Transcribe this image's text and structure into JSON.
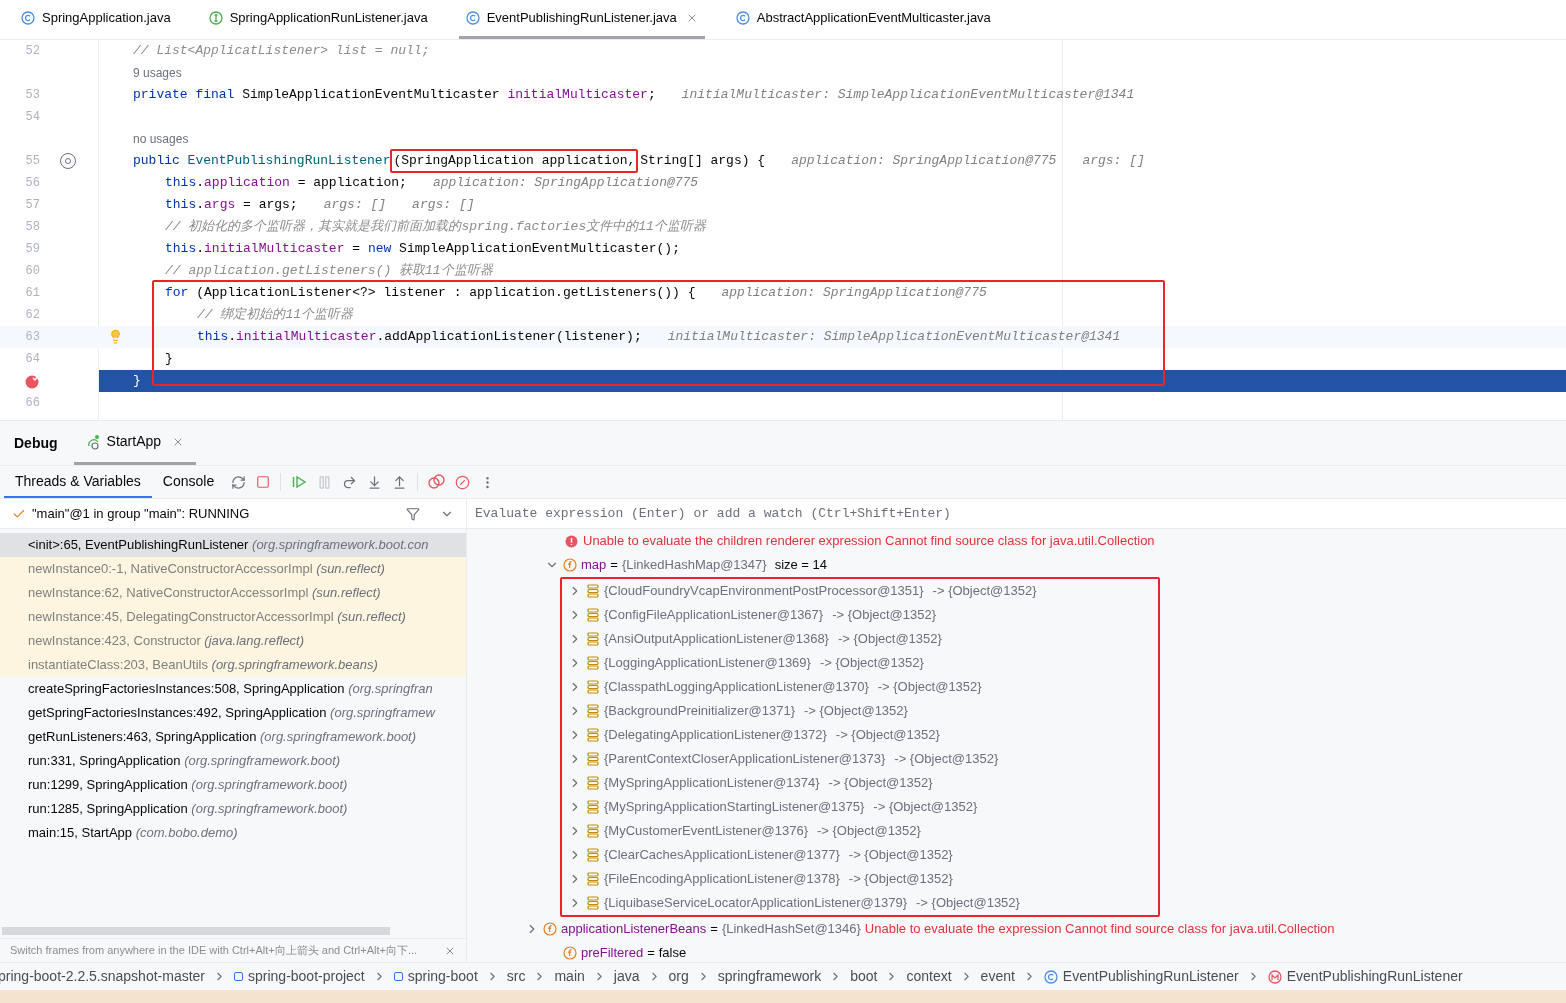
{
  "editor_tabs": [
    {
      "label": "SpringApplication.java",
      "kind": "class",
      "selected": false
    },
    {
      "label": "SpringApplicationRunListener.java",
      "kind": "interface",
      "selected": false
    },
    {
      "label": "EventPublishingRunListener.java",
      "kind": "class",
      "selected": true,
      "closable": true
    },
    {
      "label": "AbstractApplicationEventMulticaster.java",
      "kind": "class",
      "selected": false
    }
  ],
  "code": {
    "lines": [
      {
        "kind": "code",
        "number": "52",
        "tokens": [
          {
            "kind": "comment",
            "text": "// List<ApplicatListener> list = null;"
          }
        ]
      },
      {
        "kind": "usage",
        "text": "9 usages"
      },
      {
        "kind": "code",
        "number": "53",
        "tokens": [
          {
            "kind": "keyword",
            "text": "private final "
          },
          {
            "kind": "plain",
            "text": "SimpleApplicationEventMulticaster "
          },
          {
            "kind": "field",
            "text": "initialMulticaster"
          },
          {
            "kind": "plain",
            "text": ";"
          },
          {
            "kind": "hint",
            "text": "initialMulticaster: SimpleApplicationEventMulticaster@1341"
          }
        ]
      },
      {
        "kind": "code",
        "number": "54"
      },
      {
        "kind": "usage",
        "text": "no usages"
      },
      {
        "kind": "code",
        "number": "55",
        "gutter": {
          "kind": "implements"
        },
        "tokens": [
          {
            "kind": "keyword",
            "text": "public "
          },
          {
            "kind": "declaration",
            "text": "EventPublishingRunListener"
          },
          {
            "kind": "plain",
            "text": "(SpringApplication application,",
            "boxed": true
          },
          {
            "kind": "plain",
            "text": "String[] args) {"
          },
          {
            "kind": "hint",
            "text": "application: SpringApplication@775"
          },
          {
            "kind": "hint",
            "text": "args: []"
          }
        ],
        "children": [
          {
            "kind": "code",
            "number": "56",
            "tokens": [
              {
                "kind": "keyword",
                "text": "this"
              },
              {
                "kind": "plain",
                "text": "."
              },
              {
                "kind": "field",
                "text": "application"
              },
              {
                "kind": "plain",
                "text": " = application;"
              },
              {
                "kind": "hint",
                "text": "application: SpringApplication@775"
              }
            ]
          },
          {
            "kind": "code",
            "number": "57",
            "tokens": [
              {
                "kind": "keyword",
                "text": "this"
              },
              {
                "kind": "plain",
                "text": "."
              },
              {
                "kind": "field",
                "text": "args"
              },
              {
                "kind": "plain",
                "text": " = args;"
              },
              {
                "kind": "hint",
                "text": "args: []"
              },
              {
                "kind": "hint",
                "text": "args: []"
              }
            ]
          },
          {
            "kind": "code",
            "number": "58",
            "tokens": [
              {
                "kind": "comment",
                "text": "// 初始化的多个监听器，其实就是我们前面加载的spring.factories文件中的11个监听器"
              }
            ]
          },
          {
            "kind": "code",
            "number": "59",
            "tokens": [
              {
                "kind": "keyword",
                "text": "this"
              },
              {
                "kind": "plain",
                "text": "."
              },
              {
                "kind": "field",
                "text": "initialMulticaster"
              },
              {
                "kind": "plain",
                "text": " = "
              },
              {
                "kind": "keyword",
                "text": "new "
              },
              {
                "kind": "plain",
                "text": "SimpleApplicationEventMulticaster();"
              }
            ]
          },
          {
            "kind": "code",
            "number": "60",
            "tokens": [
              {
                "kind": "comment",
                "text": "// application.getListeners() 获取11个监听器"
              }
            ]
          },
          {
            "kind": "code",
            "number": "61",
            "boxed": true,
            "tokens": [
              {
                "kind": "keyword",
                "text": "for "
              },
              {
                "kind": "plain",
                "text": "(ApplicationListener<?> listener : application.getListeners()) {"
              },
              {
                "kind": "hint",
                "text": "application: SpringApplication@775"
              }
            ],
            "children": [
              {
                "kind": "code",
                "number": "62",
                "boxed": true,
                "tokens": [
                  {
                    "kind": "comment",
                    "text": "// 绑定初始的11个监听器"
                  }
                ]
              },
              {
                "kind": "code",
                "number": "63",
                "boxed": true,
                "caret": true,
                "gutter": {
                  "kind": "bulb"
                },
                "tokens": [
                  {
                    "kind": "keyword",
                    "text": "this"
                  },
                  {
                    "kind": "plain",
                    "text": "."
                  },
                  {
                    "kind": "field",
                    "text": "initialMulticaster"
                  },
                  {
                    "kind": "plain",
                    "text": ".addApplicationListener(listener);"
                  },
                  {
                    "kind": "hint",
                    "text": "initialMulticaster: SimpleApplicationEventMulticaster@1341"
                  }
                ]
              }
            ]
          },
          {
            "kind": "code",
            "number": "64",
            "boxed": true,
            "tokens": [
              {
                "kind": "plain",
                "text": "}"
              }
            ]
          }
        ]
      },
      {
        "kind": "code",
        "execution": true,
        "gutter": {
          "kind": "breakpoint"
        },
        "tokens": [
          {
            "kind": "plain",
            "text": "}"
          }
        ]
      },
      {
        "kind": "code",
        "number": "66"
      }
    ]
  },
  "debug": {
    "title": "Debug",
    "tabs": [
      {
        "label": "StartApp",
        "selected": true
      }
    ],
    "subtabs": [
      {
        "label": "Threads & Variables",
        "selected": true
      },
      {
        "label": "Console",
        "selected": false
      }
    ],
    "thread": "\"main\"@1 in group \"main\": RUNNING",
    "frames": [
      {
        "method": "<init>:65, EventPublishingRunListener",
        "package": "(org.springframework.boot.con",
        "selected": true,
        "library": false
      },
      {
        "method": "newInstance0:-1, NativeConstructorAccessorImpl",
        "package": "(sun.reflect)",
        "selected": false,
        "library": true
      },
      {
        "method": "newInstance:62, NativeConstructorAccessorImpl",
        "package": "(sun.reflect)",
        "selected": false,
        "library": true
      },
      {
        "method": "newInstance:45, DelegatingConstructorAccessorImpl",
        "package": "(sun.reflect)",
        "selected": false,
        "library": true
      },
      {
        "method": "newInstance:423, Constructor",
        "package": "(java.lang.reflect)",
        "selected": false,
        "library": true
      },
      {
        "method": "instantiateClass:203, BeanUtils",
        "package": "(org.springframework.beans)",
        "selected": false,
        "library": true
      },
      {
        "method": "createSpringFactoriesInstances:508, SpringApplication",
        "package": "(org.springfran",
        "selected": false,
        "library": false
      },
      {
        "method": "getSpringFactoriesInstances:492, SpringApplication",
        "package": "(org.springframew",
        "selected": false,
        "library": false
      },
      {
        "method": "getRunListeners:463, SpringApplication",
        "package": "(org.springframework.boot)",
        "selected": false,
        "library": false
      },
      {
        "method": "run:331, SpringApplication",
        "package": "(org.springframework.boot)",
        "selected": false,
        "library": false
      },
      {
        "method": "run:1299, SpringApplication",
        "package": "(org.springframework.boot)",
        "selected": false,
        "library": false
      },
      {
        "method": "run:1285, SpringApplication",
        "package": "(org.springframework.boot)",
        "selected": false,
        "library": false
      },
      {
        "method": "main:15, StartApp",
        "package": "(com.bobo.demo)",
        "selected": false,
        "library": false
      }
    ],
    "hint": "Switch frames from anywhere in the IDE with Ctrl+Alt+向上箭头 and Ctrl+Alt+向下...",
    "evaluate": {
      "placeholder": "Evaluate expression (Enter) or add a watch (Ctrl+Shift+Enter)"
    },
    "variables": [
      {
        "kind": "error",
        "text": "Unable to evaluate the children renderer expression Cannot find source class for java.util.Collection"
      },
      {
        "kind": "field",
        "name": "map",
        "operator": "=",
        "value": "{LinkedHashMap@1347}",
        "size": "size = 14",
        "expanded": true,
        "boxed": true,
        "children": [
          {
            "key": "{CloudFoundryVcapEnvironmentPostProcessor@1351}",
            "value": "-> {Object@1352}",
            "expanded": false
          },
          {
            "key": "{ConfigFileApplicationListener@1367}",
            "value": "-> {Object@1352}",
            "expanded": false
          },
          {
            "key": "{AnsiOutputApplicationListener@1368}",
            "value": "-> {Object@1352}",
            "expanded": false
          },
          {
            "key": "{LoggingApplicationListener@1369}",
            "value": "-> {Object@1352}",
            "expanded": false
          },
          {
            "key": "{ClasspathLoggingApplicationListener@1370}",
            "value": "-> {Object@1352}",
            "expanded": false
          },
          {
            "key": "{BackgroundPreinitializer@1371}",
            "value": "-> {Object@1352}",
            "expanded": false
          },
          {
            "key": "{DelegatingApplicationListener@1372}",
            "value": "-> {Object@1352}",
            "expanded": false
          },
          {
            "key": "{ParentContextCloserApplicationListener@1373}",
            "value": "-> {Object@1352}",
            "expanded": false
          },
          {
            "key": "{MySpringApplicationListener@1374}",
            "value": "-> {Object@1352}",
            "expanded": false
          },
          {
            "key": "{MySpringApplicationStartingListener@1375}",
            "value": "-> {Object@1352}",
            "expanded": false
          },
          {
            "key": "{MyCustomerEventListener@1376}",
            "value": "-> {Object@1352}",
            "expanded": false
          },
          {
            "key": "{ClearCachesApplicationListener@1377}",
            "value": "-> {Object@1352}",
            "expanded": false
          },
          {
            "key": "{FileEncodingApplicationListener@1378}",
            "value": "-> {Object@1352}",
            "expanded": false
          },
          {
            "key": "{LiquibaseServiceLocatorApplicationListener@1379}",
            "value": "-> {Object@1352}",
            "expanded": false
          }
        ]
      },
      {
        "kind": "field",
        "name": "applicationListenerBeans",
        "operator": "=",
        "value": "{LinkedHashSet@1346}",
        "error": "Unable to evaluate the expression Cannot find source class for java.util.Collection",
        "expanded": false
      },
      {
        "kind": "field",
        "name": "preFiltered",
        "operator": "=",
        "literal": "false"
      }
    ]
  },
  "breadcrumb": [
    {
      "label": "pring-boot-2.2.5.snapshot-master",
      "kind": "folder"
    },
    {
      "label": "spring-boot-project",
      "kind": "module"
    },
    {
      "label": "spring-boot",
      "kind": "module"
    },
    {
      "label": "src",
      "kind": "folder"
    },
    {
      "label": "main",
      "kind": "folder"
    },
    {
      "label": "java",
      "kind": "folder"
    },
    {
      "label": "org",
      "kind": "folder"
    },
    {
      "label": "springframework",
      "kind": "folder"
    },
    {
      "label": "boot",
      "kind": "folder"
    },
    {
      "label": "context",
      "kind": "folder"
    },
    {
      "label": "event",
      "kind": "folder"
    },
    {
      "label": "EventPublishingRunListener",
      "kind": "class"
    },
    {
      "label": "EventPublishingRunListener",
      "kind": "method"
    }
  ]
}
